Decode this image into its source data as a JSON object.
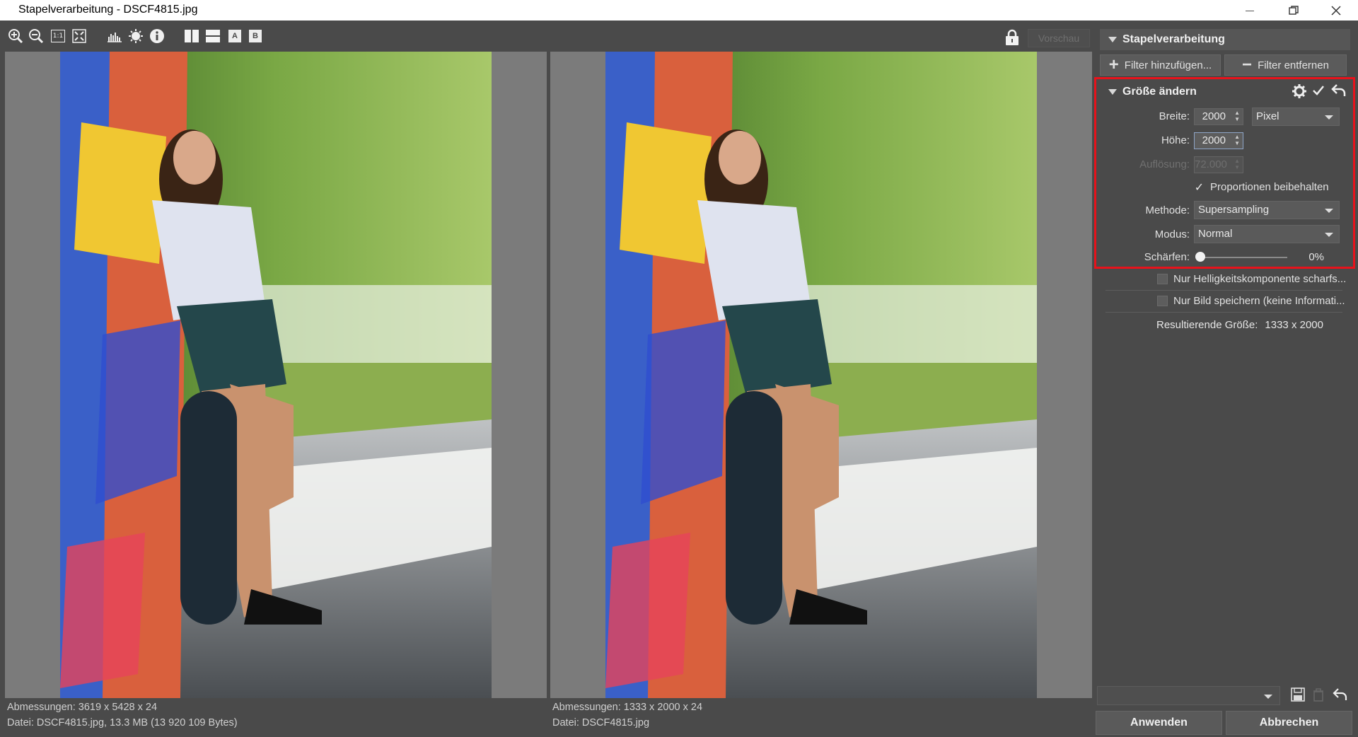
{
  "window": {
    "title": "Stapelverarbeitung - DSCF4815.jpg"
  },
  "toolbar": {
    "icons": [
      "zoom-in-icon",
      "zoom-out-icon",
      "zoom-1-1-icon",
      "fit-to-screen-icon",
      "histogram-icon",
      "exposure-icon",
      "info-icon",
      "split-vertical-icon",
      "split-horizontal-icon",
      "view-a-icon",
      "view-b-icon"
    ],
    "one_to_one": "1:1",
    "view_a": "A",
    "view_b": "B",
    "preview_label": "Vorschau"
  },
  "left_pane": {
    "dimensions": "Abmessungen: 3619 x 5428 x 24",
    "file": "Datei: DSCF4815.jpg, 13.3 MB (13 920 109 Bytes)"
  },
  "right_pane": {
    "dimensions": "Abmessungen: 1333 x 2000 x 24",
    "file": "Datei: DSCF4815.jpg"
  },
  "panel": {
    "title": "Stapelverarbeitung",
    "add_filter": "Filter hinzufügen...",
    "remove_filter": "Filter entfernen",
    "filter": {
      "title": "Größe ändern",
      "width_label": "Breite:",
      "width_value": "2000",
      "unit": "Pixel",
      "height_label": "Höhe:",
      "height_value": "2000",
      "resolution_label": "Auflösung:",
      "resolution_value": "72.000",
      "keep_proportions": "Proportionen beibehalten",
      "method_label": "Methode:",
      "method_value": "Supersampling",
      "mode_label": "Modus:",
      "mode_value": "Normal",
      "sharpen_label": "Schärfen:",
      "sharpen_value": "0%",
      "sharpen_level": 0
    },
    "only_luminance": "Nur Helligkeitskomponente scharfs...",
    "only_image": "Nur Bild speichern (keine Informati...",
    "result_label": "Resultierende Größe:",
    "result_value": "1333 x 2000",
    "apply": "Anwenden",
    "cancel": "Abbrechen"
  },
  "colors": {
    "accent_frame": "#e8121b",
    "background": "#4a4a4a"
  }
}
